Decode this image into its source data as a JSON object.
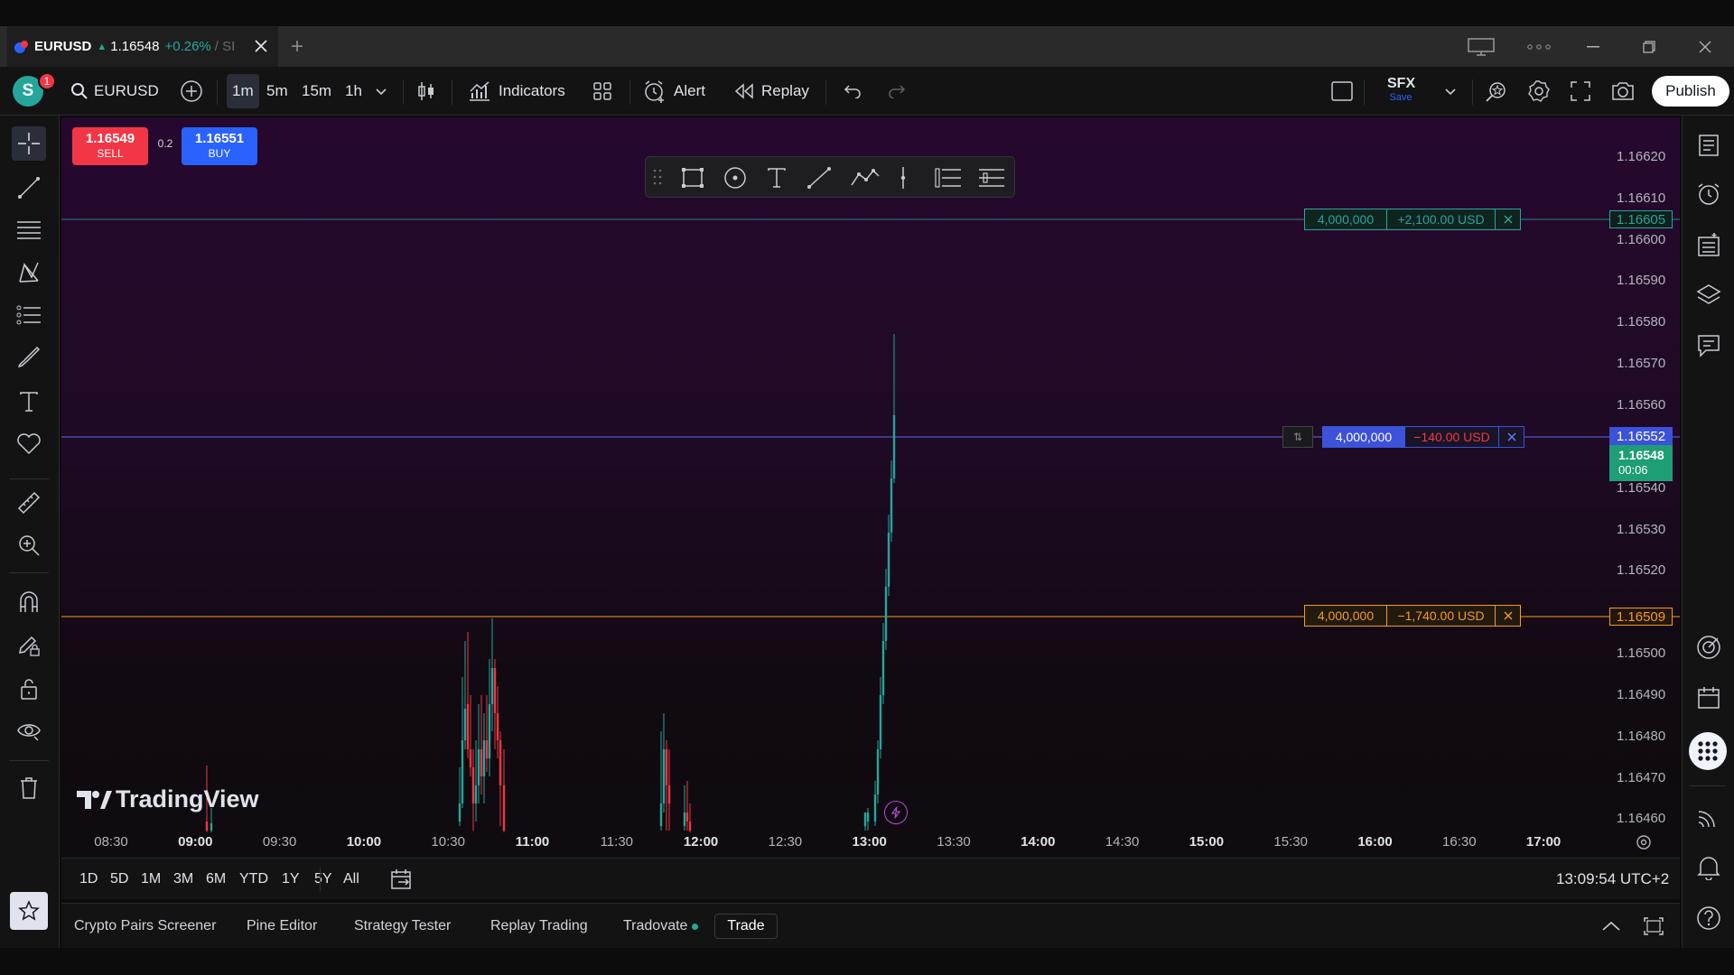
{
  "window": {
    "tab": {
      "symbol": "EURUSD",
      "price": "1.16548",
      "change": "+0.26%",
      "rest": "/ SI"
    },
    "new_tab": "+"
  },
  "toolbar": {
    "avatar": "S",
    "avatar_badge": "1",
    "symbol": "EURUSD",
    "timeframes": [
      "1m",
      "5m",
      "15m",
      "1h"
    ],
    "active_timeframe": "1m",
    "indicators": "Indicators",
    "alert": "Alert",
    "replay": "Replay",
    "layout_name": "SFX",
    "layout_save": "Save",
    "publish": "Publish"
  },
  "trade_panel": {
    "sell_price": "1.16549",
    "sell_label": "SELL",
    "spread": "0.2",
    "buy_price": "1.16551",
    "buy_label": "BUY"
  },
  "price_axis": [
    "1.16620",
    "1.16610",
    "1.16600",
    "1.16590",
    "1.16580",
    "1.16570",
    "1.16560",
    "1.16540",
    "1.16530",
    "1.16520",
    "1.16500",
    "1.16490",
    "1.16480",
    "1.16470",
    "1.16460"
  ],
  "price_tags": {
    "take_profit": "1.16605",
    "entry": "1.16552",
    "current_price": "1.16548",
    "countdown": "00:06",
    "stop_loss": "1.16509"
  },
  "orders": {
    "tp": {
      "qty": "4,000,000",
      "pnl": "+2,100.00 USD"
    },
    "entry": {
      "qty": "4,000,000",
      "pnl": "−140.00 USD",
      "reverse": "⇅"
    },
    "sl": {
      "qty": "4,000,000",
      "pnl": "−1,740.00 USD"
    }
  },
  "time_axis": [
    {
      "t": "08:30",
      "bold": false
    },
    {
      "t": "09:00",
      "bold": true
    },
    {
      "t": "09:30",
      "bold": false
    },
    {
      "t": "10:00",
      "bold": true
    },
    {
      "t": "10:30",
      "bold": false
    },
    {
      "t": "11:00",
      "bold": true
    },
    {
      "t": "11:30",
      "bold": false
    },
    {
      "t": "12:00",
      "bold": true
    },
    {
      "t": "12:30",
      "bold": false
    },
    {
      "t": "13:00",
      "bold": true
    },
    {
      "t": "13:30",
      "bold": false
    },
    {
      "t": "14:00",
      "bold": true
    },
    {
      "t": "14:30",
      "bold": false
    },
    {
      "t": "15:00",
      "bold": true
    },
    {
      "t": "15:30",
      "bold": false
    },
    {
      "t": "16:00",
      "bold": true
    },
    {
      "t": "16:30",
      "bold": false
    },
    {
      "t": "17:00",
      "bold": true
    }
  ],
  "watermark": "TradingView",
  "ranges": [
    "1D",
    "5D",
    "1M",
    "3M",
    "6M",
    "YTD",
    "1Y",
    "5Y",
    "All"
  ],
  "clock": "13:09:54 UTC+2",
  "bottom_tabs": [
    "Crypto Pairs Screener",
    "Pine Editor",
    "Strategy Tester",
    "Replay Trading",
    "Tradovate"
  ],
  "trade_tab": "Trade",
  "colors": {
    "up": "#26a69a",
    "down": "#f23645",
    "tp_line": "#26a69a",
    "entry_line": "#5b6cf0",
    "sl_line": "#f59a23",
    "accent": "#2962ff"
  }
}
